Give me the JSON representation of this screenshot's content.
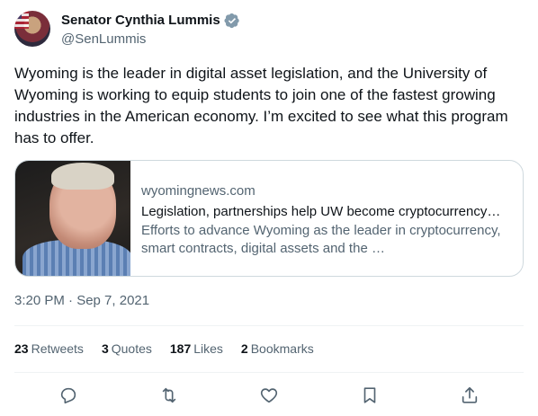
{
  "author": {
    "display_name": "Senator Cynthia Lummis",
    "handle": "@SenLummis",
    "verified_icon": "verified-badge-icon",
    "verified_color": "#829aab"
  },
  "tweet": {
    "text": "Wyoming is the leader in digital asset legislation, and the University of Wyoming is working to equip students to join one of the fastest growing industries in the American economy. I’m excited to see what this program has to offer."
  },
  "card": {
    "domain": "wyomingnews.com",
    "title": "Legislation, partnerships help UW become cryptocurrency…",
    "description": "Efforts to advance Wyoming as the leader in cryptocurrency, smart contracts, digital assets and the …"
  },
  "timestamp": "3:20 PM · Sep 7, 2021",
  "stats": {
    "retweets_count": "23",
    "retweets_label": "Retweets",
    "quotes_count": "3",
    "quotes_label": "Quotes",
    "likes_count": "187",
    "likes_label": "Likes",
    "bookmarks_count": "2",
    "bookmarks_label": "Bookmarks"
  },
  "actions": [
    "reply-icon",
    "retweet-icon",
    "like-icon",
    "bookmark-icon",
    "share-icon"
  ],
  "colors": {
    "text": "#0f1419",
    "secondary": "#536471",
    "border": "#cfd9de",
    "divider": "#eff3f4"
  }
}
